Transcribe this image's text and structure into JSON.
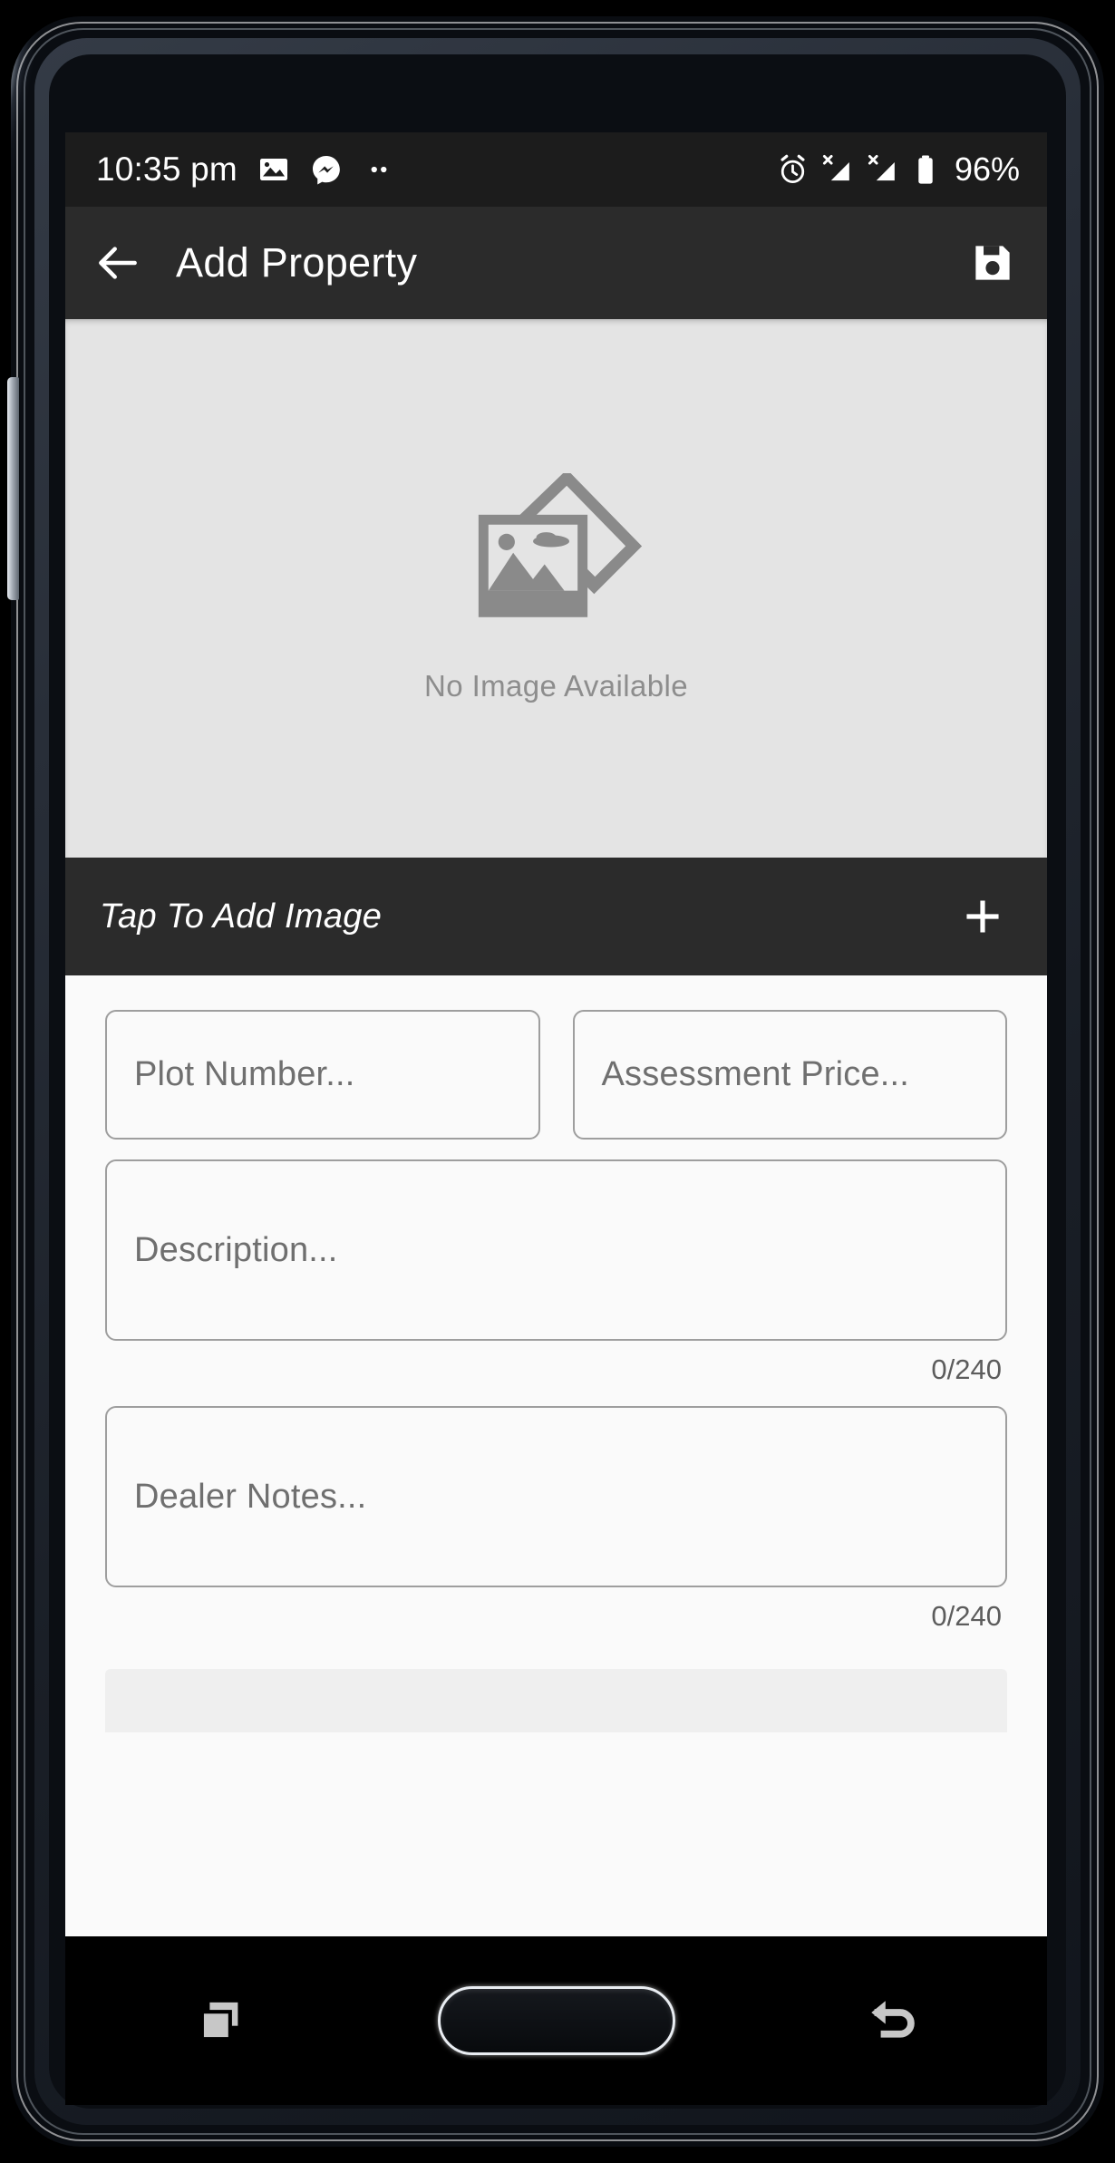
{
  "device": {
    "type": "android-phone",
    "buttons": {
      "volume_rocker": "volume-rocker",
      "home": "home-button",
      "recents": "recents-key",
      "back": "back-key"
    }
  },
  "status_bar": {
    "time": "10:35 pm",
    "left_icons": [
      "photo-icon",
      "messenger-icon",
      "more-dots-icon"
    ],
    "right_icons": [
      "alarm-icon",
      "no-signal-sim1-icon",
      "no-signal-sim2-icon",
      "battery-icon"
    ],
    "battery_percent": "96%",
    "background": "#1c1c1c",
    "foreground": "#ffffff"
  },
  "app_bar": {
    "back_icon": "arrow-left-icon",
    "title": "Add Property",
    "save_icon": "save-floppy-icon",
    "background": "#2b2b2b",
    "foreground": "#ffffff"
  },
  "image_preview": {
    "placeholder_icon": "photo-stack-icon",
    "placeholder_text": "No Image Available",
    "background": "#e4e4e4",
    "text_color": "#8d8d8d"
  },
  "add_image_bar": {
    "label": "Tap To Add Image",
    "add_icon": "plus-icon",
    "background": "#2b2b2b",
    "foreground": "#ffffff"
  },
  "form": {
    "background": "#fafafa",
    "border_color": "#9e9e9e",
    "placeholder_color": "#6f6f6f",
    "fields": [
      {
        "name": "plot-number",
        "placeholder": "Plot Number...",
        "value": ""
      },
      {
        "name": "assessment-price",
        "placeholder": "Assessment Price...",
        "value": ""
      },
      {
        "name": "description",
        "placeholder": "Description...",
        "value": "",
        "counter": "0/240"
      },
      {
        "name": "dealer-notes",
        "placeholder": "Dealer Notes...",
        "value": "",
        "counter": "0/240"
      }
    ]
  }
}
